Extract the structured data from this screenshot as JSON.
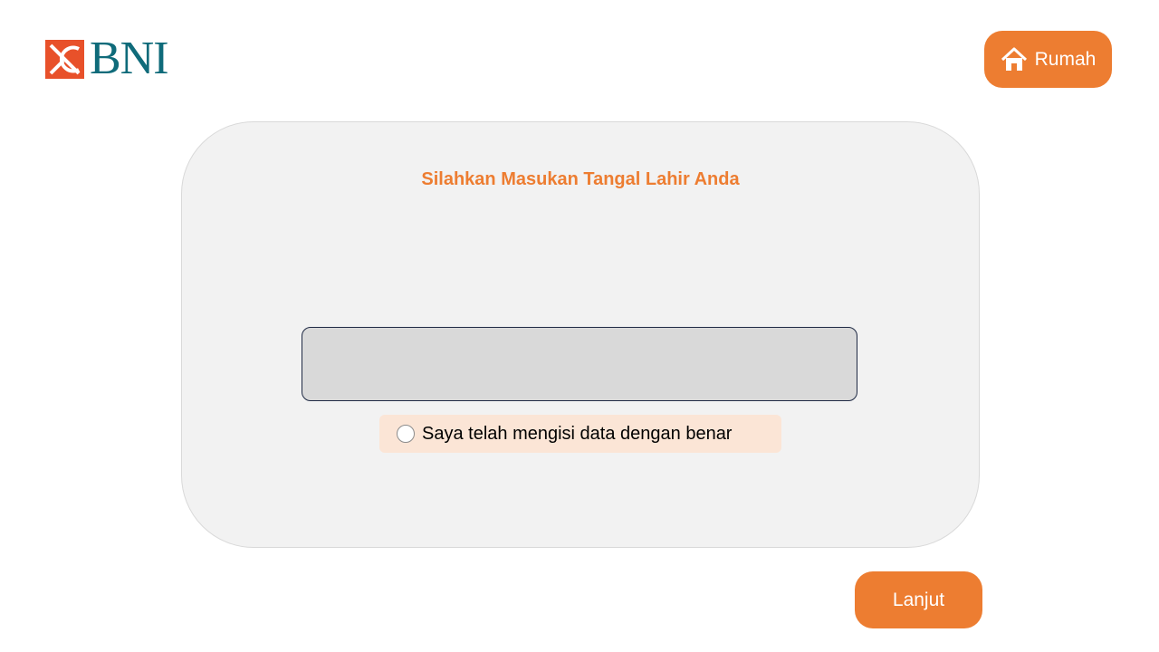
{
  "brand": {
    "logo_text": "BNI",
    "logo_mark_icon": "bni-logo-mark-icon",
    "logo_color": "#0f6b7a",
    "mark_color": "#e8512a"
  },
  "header": {
    "home_button_label": "Rumah",
    "home_icon": "house-icon"
  },
  "form": {
    "title": "Silahkan Masukan Tangal Lahir Anda",
    "date_input_value": "",
    "date_input_placeholder": "",
    "confirm_label": "Saya telah mengisi data dengan benar",
    "confirm_checked": false
  },
  "footer": {
    "next_button_label": "Lanjut"
  },
  "colors": {
    "accent": "#ed7d31",
    "card_background": "#f2f2f2",
    "input_background": "#d9d9d9",
    "confirm_background": "#fbe5d6"
  }
}
